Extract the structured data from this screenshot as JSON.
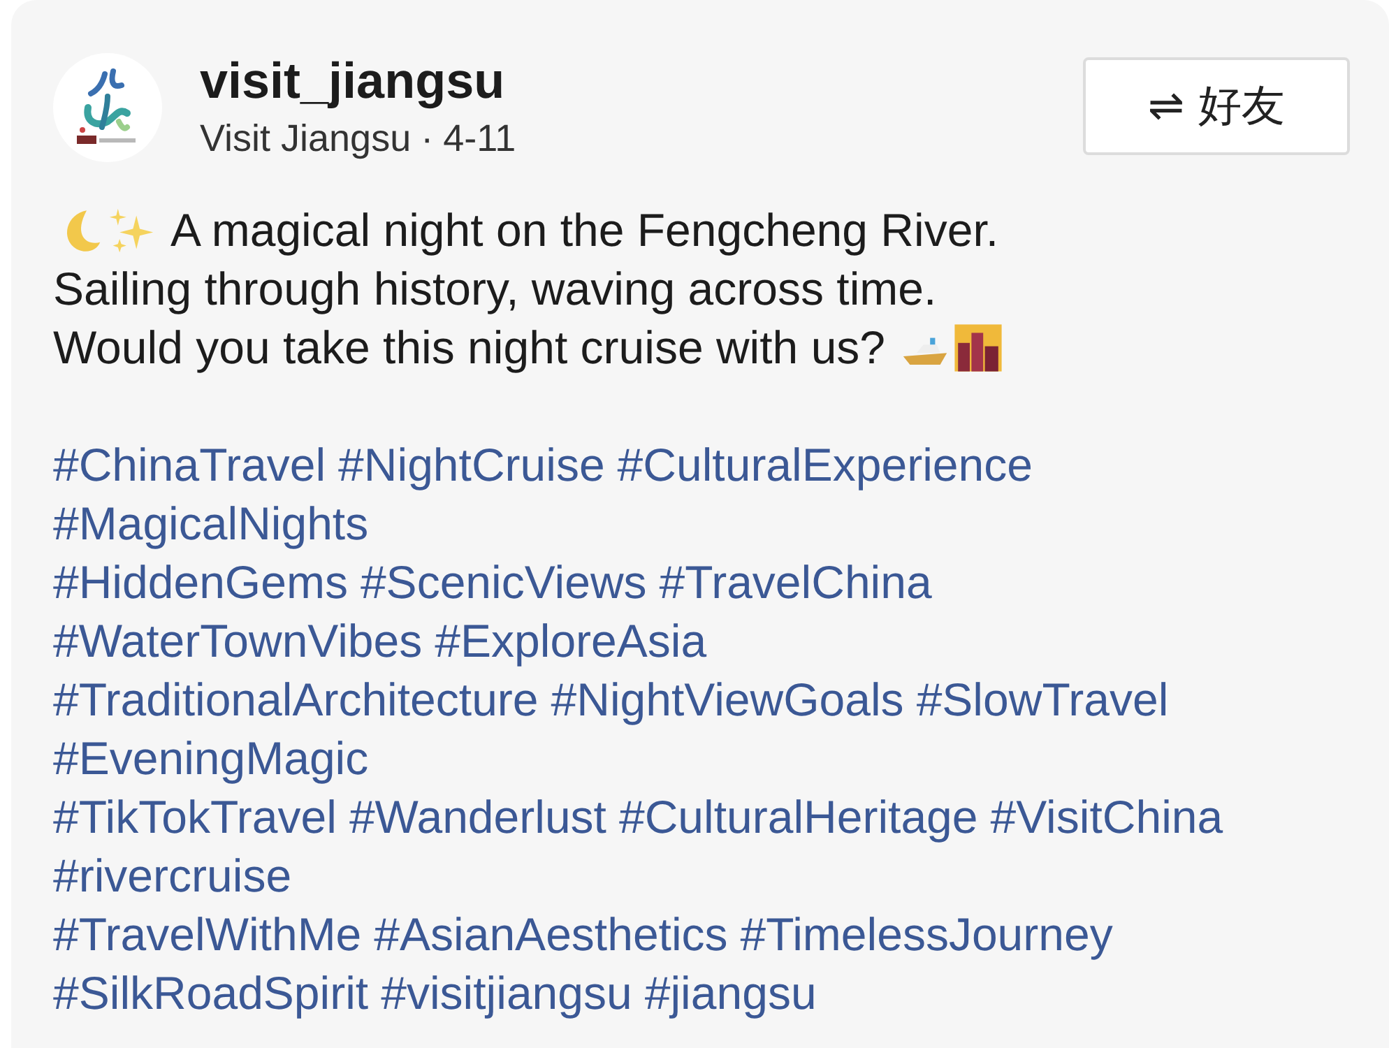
{
  "post": {
    "username": "visit_jiangsu",
    "display_name": "Visit Jiangsu",
    "separator": "·",
    "date": "4-11",
    "follow_button": {
      "icon": "⇌",
      "label": "好友"
    },
    "caption_lines": [
      [
        {
          "kind": "moon"
        },
        {
          "kind": "sparkles"
        },
        {
          "kind": "text",
          "text": "A magical night on the Fengcheng River."
        }
      ],
      [
        {
          "kind": "text",
          "text": "Sailing through history, waving across time."
        }
      ],
      [
        {
          "kind": "text",
          "text": "Would you take this night cruise with us?"
        },
        {
          "kind": "boat"
        },
        {
          "kind": "city"
        }
      ]
    ],
    "hashtag_lines": [
      [
        "#ChinaTravel",
        "#NightCruise",
        "#CulturalExperience"
      ],
      [
        "#MagicalNights"
      ],
      [
        "#HiddenGems",
        "#ScenicViews",
        "#TravelChina"
      ],
      [
        "#WaterTownVibes",
        "#ExploreAsia"
      ],
      [
        "#TraditionalArchitecture",
        "#NightViewGoals",
        "#SlowTravel"
      ],
      [
        "#EveningMagic"
      ],
      [
        "#TikTokTravel",
        "#Wanderlust",
        "#CulturalHeritage",
        "#VisitChina"
      ],
      [
        "#rivercruise"
      ],
      [
        "#TravelWithMe",
        "#AsianAesthetics",
        "#TimelessJourney"
      ],
      [
        "#SilkRoadSpirit",
        "#visitjiangsu",
        "#jiangsu"
      ]
    ]
  }
}
